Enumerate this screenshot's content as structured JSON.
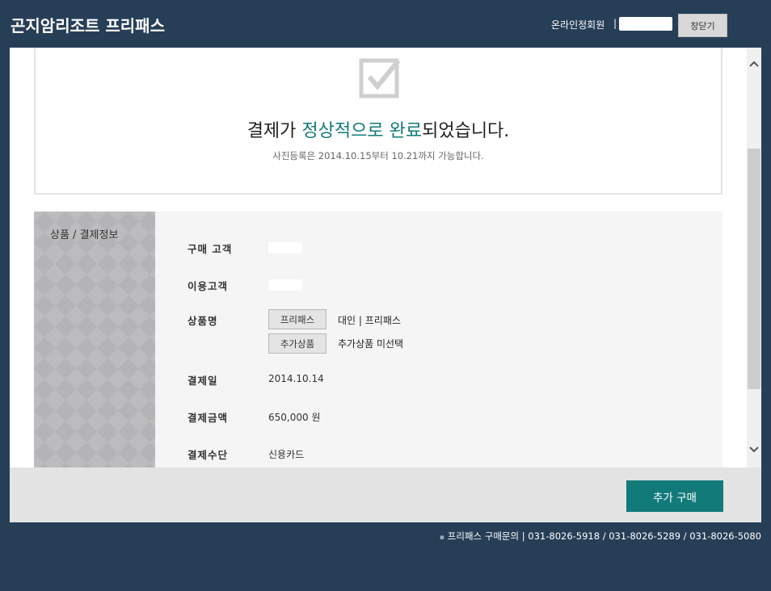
{
  "header": {
    "title": "곤지암리조트 프리패스",
    "member_label": "온라인정회원",
    "member_sep": "|",
    "close_label": "창닫기"
  },
  "confirmation": {
    "message_prefix": "결제가 ",
    "message_accent": "정상적으로 완료",
    "message_suffix": "되었습니다.",
    "subtext": "사진등록은 2014.10.15부터 10.21까지 가능합니다.",
    "icon": "checkbox-check-icon"
  },
  "info": {
    "section_title": "상품 / 결제정보",
    "labels": {
      "buyer": "구매 고객",
      "user": "이용고객",
      "product": "상품명",
      "date": "결제일",
      "amount": "결제금액",
      "method": "결제수단"
    },
    "products": [
      {
        "tag": "프리패스",
        "desc": "대인 | 프리패스"
      },
      {
        "tag": "추가상품",
        "desc": "추가상품 미선택"
      }
    ],
    "date": "2014.10.14",
    "amount": "650,000 원",
    "method": "신용카드"
  },
  "actions": {
    "buy_more": "추가 구매"
  },
  "contact": {
    "bullet": "▪",
    "text": "프리패스 구매문의 | 031-8026-5918 / 031-8026-5289 / 031-8026-5080"
  },
  "colors": {
    "background": "#273e57",
    "accent": "#117a75",
    "button": "#137a7a"
  }
}
